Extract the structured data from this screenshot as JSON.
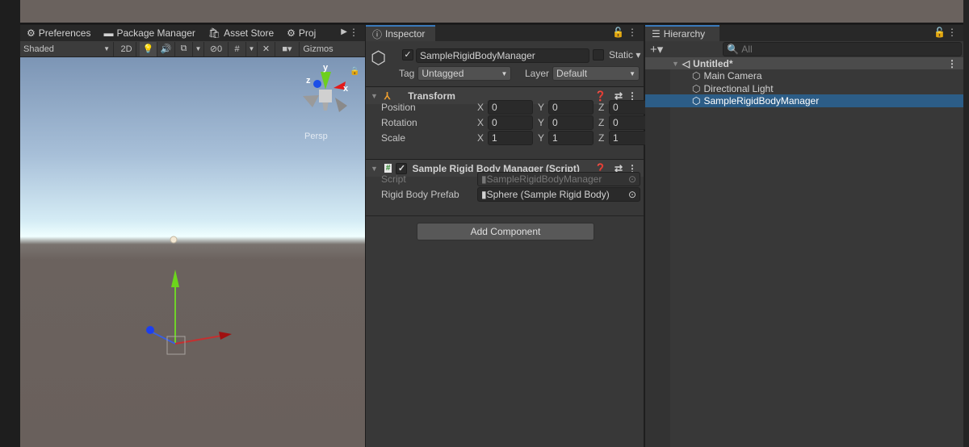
{
  "scene": {
    "tabs": [
      {
        "label": "Preferences",
        "icon": "gear-icon"
      },
      {
        "label": "Package Manager",
        "icon": "package-icon"
      },
      {
        "label": "Asset Store",
        "icon": "store-bag-icon"
      },
      {
        "label": "Proj",
        "icon": "gear-icon"
      }
    ],
    "toolbar": {
      "shading": "Shaded",
      "mode_2d": "2D",
      "hidden_count": "0",
      "gizmos": "Gizmos"
    },
    "view_gizmo": {
      "x": "x",
      "y": "y",
      "z": "z",
      "projection": "Persp"
    }
  },
  "inspector": {
    "tab": "Inspector",
    "object_name": "SampleRigidBodyManager",
    "active": true,
    "static_label": "Static",
    "tag_label": "Tag",
    "tag": "Untagged",
    "layer_label": "Layer",
    "layer": "Default",
    "transform": {
      "title": "Transform",
      "rows": [
        {
          "label": "Position",
          "x": "0",
          "y": "0",
          "z": "0"
        },
        {
          "label": "Rotation",
          "x": "0",
          "y": "0",
          "z": "0"
        },
        {
          "label": "Scale",
          "x": "1",
          "y": "1",
          "z": "1"
        }
      ],
      "axes": {
        "x": "X",
        "y": "Y",
        "z": "Z"
      }
    },
    "script_component": {
      "title": "Sample Rigid Body Manager (Script)",
      "enabled": true,
      "script_label": "Script",
      "script_value": "SampleRigidBodyManager",
      "prefab_label": "Rigid Body Prefab",
      "prefab_value": "Sphere (Sample Rigid Body)"
    },
    "add_component": "Add Component"
  },
  "hierarchy": {
    "tab": "Hierarchy",
    "search_placeholder": "All",
    "scene": "Untitled*",
    "items": [
      {
        "label": "Main Camera",
        "selected": false
      },
      {
        "label": "Directional Light",
        "selected": false
      },
      {
        "label": "SampleRigidBodyManager",
        "selected": true
      }
    ]
  },
  "colors": {
    "selection": "#2c5d87",
    "accent": "#3a79bb"
  }
}
